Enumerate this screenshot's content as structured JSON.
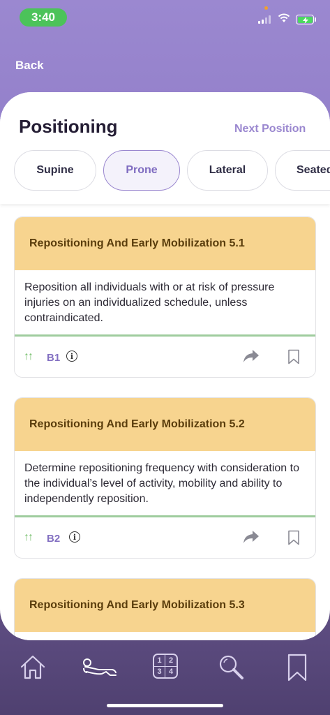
{
  "status_bar": {
    "time": "3:40"
  },
  "nav": {
    "back_label": "Back"
  },
  "header": {
    "title": "Positioning",
    "next_label": "Next Position"
  },
  "tabs": [
    {
      "label": "Supine",
      "active": false
    },
    {
      "label": "Prone",
      "active": true
    },
    {
      "label": "Lateral",
      "active": false
    },
    {
      "label": "Seated",
      "active": false
    }
  ],
  "cards": [
    {
      "title": "Repositioning And Early Mobilization 5.1",
      "body": "Reposition all individuals with or at risk of pressure injuries on an individualized schedule, unless contraindicated.",
      "grade_arrows": "↑↑",
      "grade_code": "B1"
    },
    {
      "title": "Repositioning And Early Mobilization 5.2",
      "body": "Determine repositioning frequency with consideration to the individual’s level of activity, mobility and ability to independently reposition.",
      "grade_arrows": "↑↑",
      "grade_code": "B2"
    },
    {
      "title": "Repositioning And Early Mobilization 5.3",
      "body": "",
      "grade_arrows": "",
      "grade_code": ""
    }
  ],
  "icons": {
    "info": "i",
    "tab_home": "home-icon",
    "tab_positioning": "lying-person-icon",
    "tab_grid": "number-grid-icon",
    "tab_search": "search-icon",
    "tab_bookmark": "bookmark-icon"
  },
  "grid_numbers": [
    "1",
    "2",
    "3",
    "4"
  ],
  "colors": {
    "accent": "#9a87cf",
    "card_header": "#f7d48f",
    "grade_green": "#77c06e",
    "time_pill": "#4cc35a"
  }
}
